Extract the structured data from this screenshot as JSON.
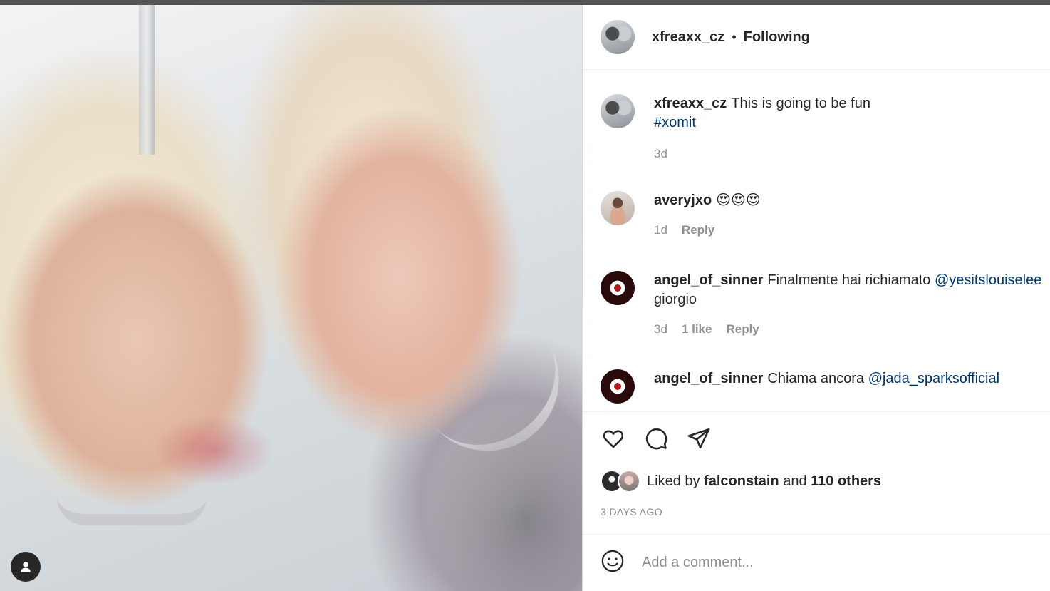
{
  "post": {
    "owner": "xfreaxx_cz",
    "follow_status": "Following",
    "separator": "•"
  },
  "comments": [
    {
      "username": "xfreaxx_cz",
      "text": "This is going to be fun",
      "hashtag": "#xomit",
      "time": "3d"
    },
    {
      "username": "averyjxo",
      "text": "😍😍😍",
      "time": "1d",
      "reply": "Reply"
    },
    {
      "username": "angel_of_sinner",
      "text": "Finalmente hai richiamato",
      "mention": "@yesitslouiselee",
      "text2": "giorgio",
      "time": "3d",
      "likes": "1 like",
      "reply": "Reply"
    },
    {
      "username": "angel_of_sinner",
      "text": "Chiama ancora",
      "mention": "@jada_sparksofficial"
    }
  ],
  "likes": {
    "prefix": "Liked by",
    "user": "falconstain",
    "and": "and",
    "others": "110 others"
  },
  "timestamp": "3 DAYS AGO",
  "add_comment": {
    "placeholder": "Add a comment..."
  },
  "icons": {
    "like": "heart-icon",
    "comment": "comment-icon",
    "share": "share-icon",
    "emoji": "emoji-icon",
    "user_tag": "user-tag-icon"
  },
  "colors": {
    "link": "#00376b",
    "muted": "#8e8e8e",
    "text": "#262626"
  }
}
